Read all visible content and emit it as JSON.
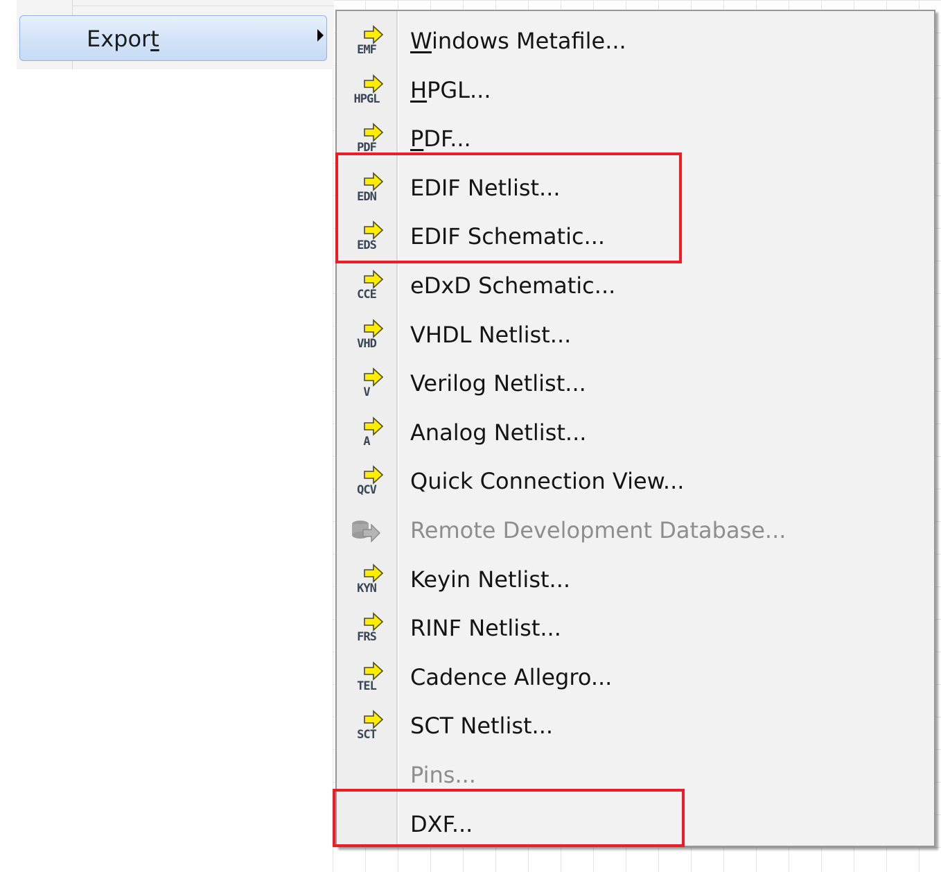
{
  "parent_menu": {
    "export_label_before": "Expor",
    "export_label_mnemonic": "t",
    "export_label_after": ""
  },
  "submenu": {
    "items": [
      {
        "label_pre": "",
        "mnemonic": "W",
        "label_post": "indows Metafile...",
        "icon_tag": "EMF",
        "icon": "export-emf-icon",
        "enabled": true
      },
      {
        "label_pre": "",
        "mnemonic": "H",
        "label_post": "PGL...",
        "icon_tag": "HPGL",
        "icon": "export-hpgl-icon",
        "enabled": true
      },
      {
        "label_pre": "",
        "mnemonic": "P",
        "label_post": "DF...",
        "icon_tag": "PDF",
        "icon": "export-pdf-icon",
        "enabled": true
      },
      {
        "label_pre": "EDIF Netlist...",
        "mnemonic": "",
        "label_post": "",
        "icon_tag": "EDN",
        "icon": "export-edn-icon",
        "enabled": true
      },
      {
        "label_pre": "EDIF Schematic...",
        "mnemonic": "",
        "label_post": "",
        "icon_tag": "EDS",
        "icon": "export-eds-icon",
        "enabled": true
      },
      {
        "label_pre": "eDxD Schematic...",
        "mnemonic": "",
        "label_post": "",
        "icon_tag": "CCE",
        "icon": "export-cce-icon",
        "enabled": true
      },
      {
        "label_pre": "VHDL Netlist...",
        "mnemonic": "",
        "label_post": "",
        "icon_tag": "VHD",
        "icon": "export-vhd-icon",
        "enabled": true
      },
      {
        "label_pre": "Verilog Netlist...",
        "mnemonic": "",
        "label_post": "",
        "icon_tag": "V",
        "icon": "export-v-icon",
        "enabled": true
      },
      {
        "label_pre": "Analog Netlist...",
        "mnemonic": "",
        "label_post": "",
        "icon_tag": "A",
        "icon": "export-a-icon",
        "enabled": true
      },
      {
        "label_pre": "Quick Connection View...",
        "mnemonic": "",
        "label_post": "",
        "icon_tag": "QCV",
        "icon": "export-qcv-icon",
        "enabled": true
      },
      {
        "label_pre": "Remote Development Database...",
        "mnemonic": "",
        "label_post": "",
        "icon_tag": "",
        "icon": "remote-database-icon",
        "enabled": false
      },
      {
        "label_pre": "Keyin Netlist...",
        "mnemonic": "",
        "label_post": "",
        "icon_tag": "KYN",
        "icon": "export-kyn-icon",
        "enabled": true
      },
      {
        "label_pre": "RINF Netlist...",
        "mnemonic": "",
        "label_post": "",
        "icon_tag": "FRS",
        "icon": "export-frs-icon",
        "enabled": true
      },
      {
        "label_pre": "Cadence Allegro...",
        "mnemonic": "",
        "label_post": "",
        "icon_tag": "TEL",
        "icon": "export-tel-icon",
        "enabled": true
      },
      {
        "label_pre": "SCT Netlist...",
        "mnemonic": "",
        "label_post": "",
        "icon_tag": "SCT",
        "icon": "export-sct-icon",
        "enabled": true
      },
      {
        "label_pre": "Pins...",
        "mnemonic": "",
        "label_post": "",
        "icon_tag": "",
        "icon": "",
        "enabled": false
      },
      {
        "label_pre": "DXF...",
        "mnemonic": "",
        "label_post": "",
        "icon_tag": "",
        "icon": "",
        "enabled": true
      }
    ]
  },
  "colors": {
    "highlight_border": "#ee1c24",
    "arrow_fill": "#ffee00",
    "disabled_text": "#8d8d8d"
  }
}
